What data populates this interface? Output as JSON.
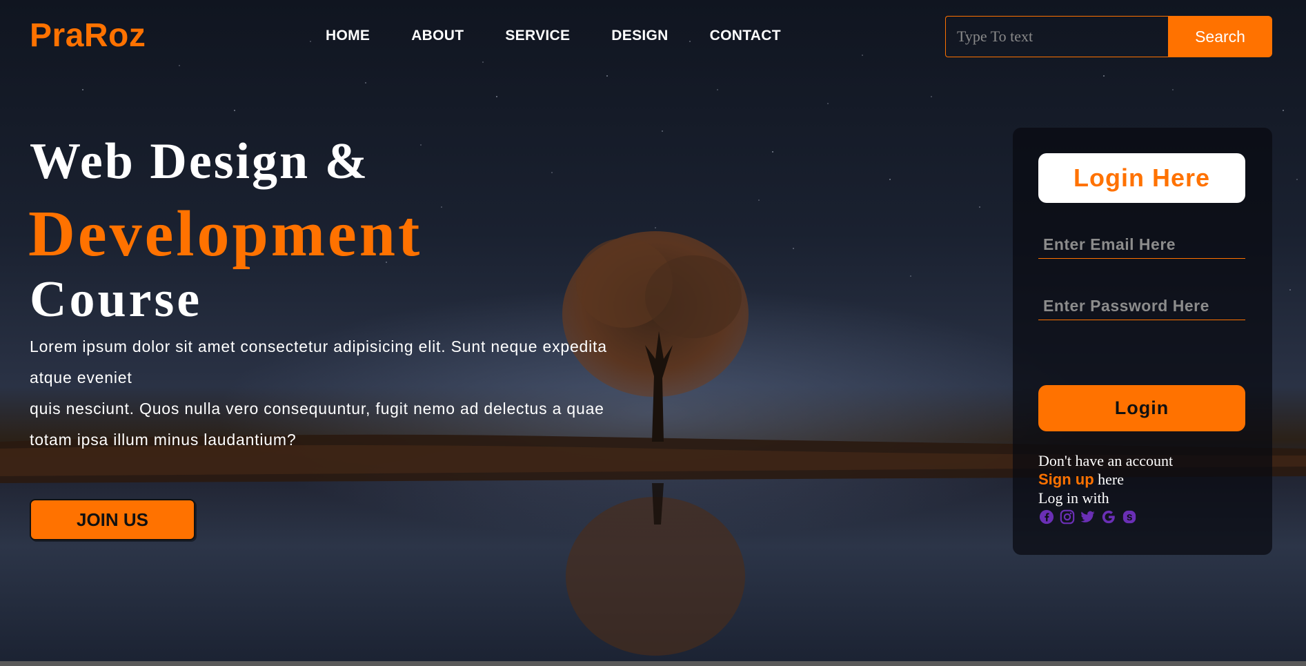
{
  "brand": {
    "name": "PraRoz",
    "accent": "#ff7200"
  },
  "nav": {
    "items": [
      {
        "label": "HOME"
      },
      {
        "label": "ABOUT"
      },
      {
        "label": "SERVICE"
      },
      {
        "label": "DESIGN"
      },
      {
        "label": "CONTACT"
      }
    ]
  },
  "search": {
    "placeholder": "Type To text",
    "button_label": "Search"
  },
  "hero": {
    "line1": "Web Design &",
    "line2": "Development",
    "line3": "Course",
    "description": "Lorem ipsum dolor sit amet consectetur adipisicing elit. Sunt neque expedita atque eveniet",
    "description2": "quis nesciunt. Quos nulla vero consequuntur, fugit nemo ad delectus a quae totam ipsa illum minus laudantium?",
    "cta_label": "JOIN US"
  },
  "login": {
    "title": "Login Here",
    "email_placeholder": "Enter Email Here",
    "password_placeholder": "Enter Password Here",
    "button_label": "Login",
    "no_account_text": "Don't have an account",
    "signup_link": "Sign up",
    "signup_suffix": " here",
    "login_with_text": "Log in with",
    "social_icons": [
      "facebook-icon",
      "instagram-icon",
      "twitter-icon",
      "google-icon",
      "skype-icon"
    ],
    "social_color": "#6a2fb5"
  }
}
